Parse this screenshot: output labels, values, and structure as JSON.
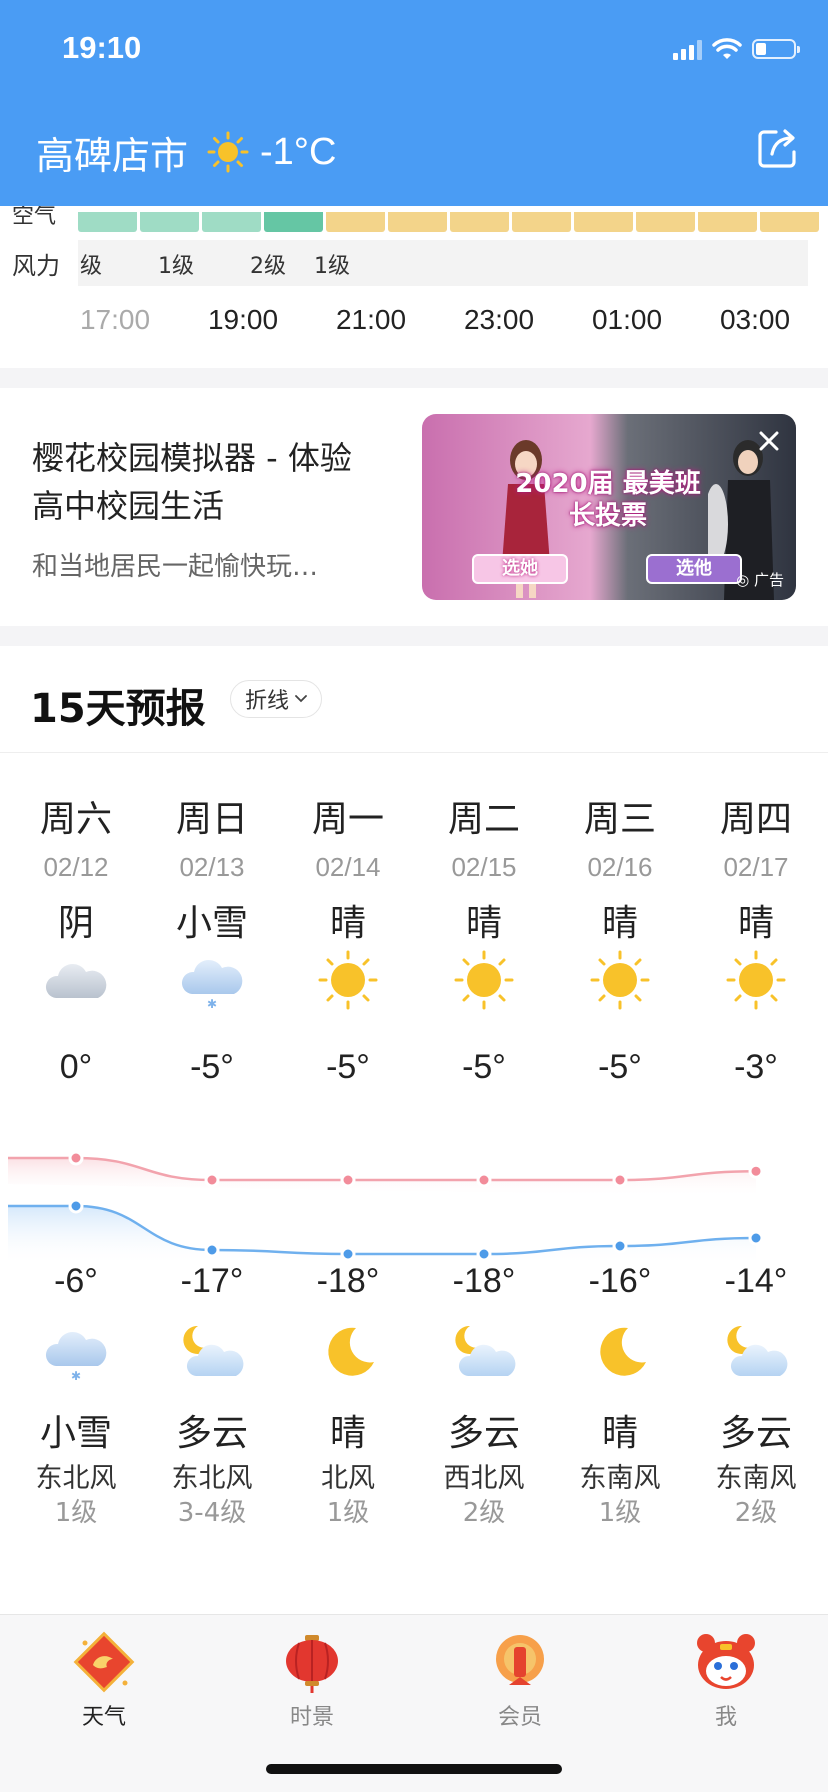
{
  "status_bar": {
    "time": "19:10"
  },
  "header": {
    "city": "高碑店市",
    "current_temp": "-1°C",
    "weather_icon": "sun-icon",
    "share_icon": "share-icon"
  },
  "hourly": {
    "air_label": "空气",
    "wind_label": "风力",
    "wind_cells": [
      "级",
      "1级",
      "2级",
      "1级"
    ],
    "hours": [
      "17:00",
      "19:00",
      "21:00",
      "23:00",
      "01:00",
      "03:00"
    ]
  },
  "ad": {
    "title": "樱花校园模拟器 - 体验高中校园生活",
    "description": "和当地居民一起愉快玩…",
    "image_headline": "2020届 最美班长投票",
    "vote_left": "选她",
    "vote_right": "选他",
    "tag": "广告"
  },
  "forecast": {
    "title": "15天预报",
    "mode": "折线",
    "days": [
      {
        "week": "周六",
        "date": "02/12",
        "day_cond": "阴",
        "day_icon": "cloudy-icon",
        "high": "0°",
        "low": "-6°",
        "night_icon": "light-snow-icon",
        "night_cond": "小雪",
        "wind_dir": "东北风",
        "wind_level": "1级",
        "high_value": 0,
        "low_value": -6
      },
      {
        "week": "周日",
        "date": "02/13",
        "day_cond": "小雪",
        "day_icon": "light-snow-icon",
        "high": "-5°",
        "low": "-17°",
        "night_icon": "partly-cloudy-night-icon",
        "night_cond": "多云",
        "wind_dir": "东北风",
        "wind_level": "3-4级",
        "high_value": -5,
        "low_value": -17
      },
      {
        "week": "周一",
        "date": "02/14",
        "day_cond": "晴",
        "day_icon": "sun-icon",
        "high": "-5°",
        "low": "-18°",
        "night_icon": "moon-icon",
        "night_cond": "晴",
        "wind_dir": "北风",
        "wind_level": "1级",
        "high_value": -5,
        "low_value": -18
      },
      {
        "week": "周二",
        "date": "02/15",
        "day_cond": "晴",
        "day_icon": "sun-icon",
        "high": "-5°",
        "low": "-18°",
        "night_icon": "partly-cloudy-night-icon",
        "night_cond": "多云",
        "wind_dir": "西北风",
        "wind_level": "2级",
        "high_value": -5,
        "low_value": -18
      },
      {
        "week": "周三",
        "date": "02/16",
        "day_cond": "晴",
        "day_icon": "sun-icon",
        "high": "-5°",
        "low": "-16°",
        "night_icon": "moon-icon",
        "night_cond": "晴",
        "wind_dir": "东南风",
        "wind_level": "1级",
        "high_value": -5,
        "low_value": -16
      },
      {
        "week": "周四",
        "date": "02/17",
        "day_cond": "晴",
        "day_icon": "sun-icon",
        "high": "-3°",
        "low": "-14°",
        "night_icon": "partly-cloudy-night-icon",
        "night_cond": "多云",
        "wind_dir": "东南风",
        "wind_level": "2级",
        "high_value": -3,
        "low_value": -14
      }
    ]
  },
  "tabs": [
    {
      "label": "天气",
      "icon": "weather-tab-icon",
      "active": true
    },
    {
      "label": "时景",
      "icon": "lantern-icon",
      "active": false
    },
    {
      "label": "会员",
      "icon": "member-icon",
      "active": false
    },
    {
      "label": "我",
      "icon": "profile-tiger-icon",
      "active": false
    }
  ],
  "colors": {
    "header_blue": "#4a9cf4",
    "high_line": "#f2a3ad",
    "low_line": "#6fb0ee",
    "sun": "#f8c22a"
  }
}
